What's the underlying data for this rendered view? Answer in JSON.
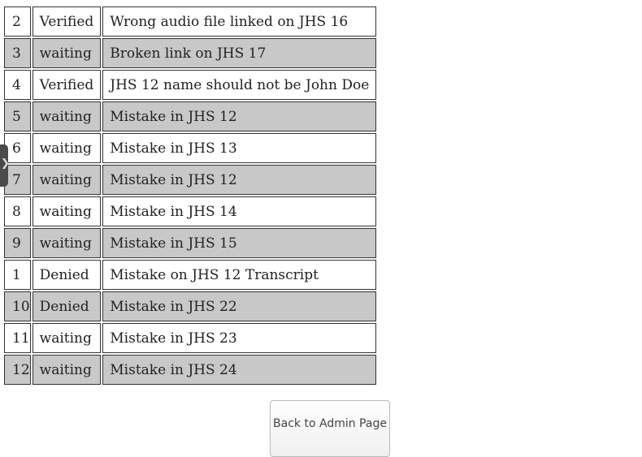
{
  "reports": [
    {
      "id": "2",
      "status": "Verified",
      "description": "Wrong audio file linked on JHS 16"
    },
    {
      "id": "3",
      "status": "waiting",
      "description": "Broken link on JHS 17"
    },
    {
      "id": "4",
      "status": "Verified",
      "description": "JHS 12 name should not be John Doe"
    },
    {
      "id": "5",
      "status": "waiting",
      "description": "Mistake in JHS 12"
    },
    {
      "id": "6",
      "status": "waiting",
      "description": "Mistake in JHS 13"
    },
    {
      "id": "7",
      "status": "waiting",
      "description": "Mistake in JHS 12"
    },
    {
      "id": "8",
      "status": "waiting",
      "description": "Mistake in JHS 14"
    },
    {
      "id": "9",
      "status": "waiting",
      "description": "Mistake in JHS 15"
    },
    {
      "id": "1",
      "status": "Denied",
      "description": "Mistake on JHS 12 Transcript"
    },
    {
      "id": "10",
      "status": "Denied",
      "description": "Mistake in JHS 22"
    },
    {
      "id": "11",
      "status": "waiting",
      "description": "Mistake in JHS 23"
    },
    {
      "id": "12",
      "status": "waiting",
      "description": "Mistake in JHS 24"
    }
  ],
  "back_button": {
    "label": "Back to Admin Page"
  },
  "side_handle": {
    "icon": "chevron-right-icon",
    "glyph": "❯"
  },
  "colors": {
    "alt_row": "#c8c8c8",
    "row": "#ffffff",
    "border": "#333333"
  }
}
